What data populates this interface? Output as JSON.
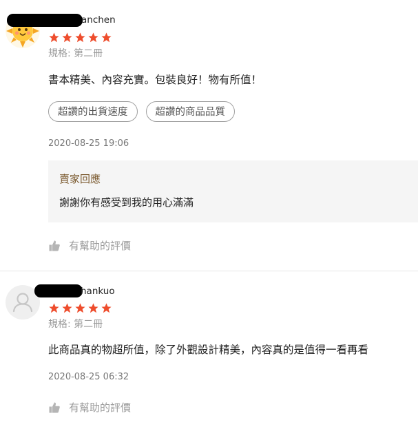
{
  "reviews": [
    {
      "username": "anchen",
      "avatar": "sun-emoji-avatar",
      "rating": 5,
      "variant": "規格: 第二冊",
      "content": "書本精美、內容充實。包裝良好！物有所值！",
      "tags": [
        "超讚的出貨速度",
        "超讚的商品品質"
      ],
      "datetime": "2020-08-25 19:06",
      "reply": {
        "title": "賣家回應",
        "text": "謝謝你有感受到我的用心滿滿"
      },
      "helpful_label": "有幫助的評價"
    },
    {
      "username": "hankuo",
      "avatar": "default-user-avatar",
      "rating": 5,
      "variant": "規格: 第二冊",
      "content": "此商品真的物超所值，除了外觀設計精美，內容真的是值得一看再看",
      "datetime": "2020-08-25 06:32",
      "helpful_label": "有幫助的評價"
    }
  ],
  "colors": {
    "star": "#ee4d2d",
    "reply_title": "#7b5a2f",
    "muted": "#9b9b9b"
  },
  "icons": {
    "star": "star-icon",
    "thumb": "thumb-up-icon"
  }
}
